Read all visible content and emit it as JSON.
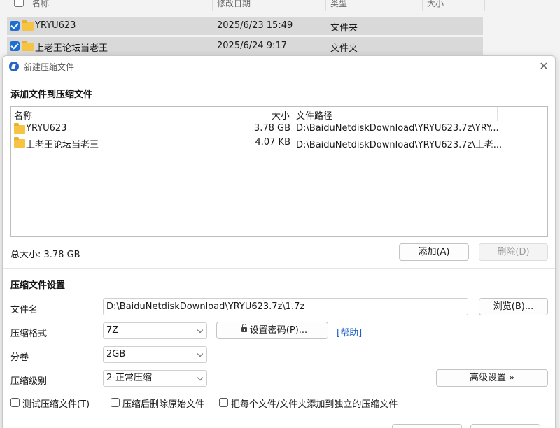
{
  "background_explorer": {
    "columns": [
      "名称",
      "修改日期",
      "类型",
      "大小"
    ],
    "rows": [
      {
        "name": "YRYU623",
        "date": "2025/6/23 15:49",
        "type": "文件夹"
      },
      {
        "name": "上老王论坛当老王",
        "date": "2025/6/24 9:17",
        "type": "文件夹"
      }
    ]
  },
  "dialog": {
    "title": "新建压缩文件",
    "add_section_title": "添加文件到压缩文件",
    "file_list": {
      "columns": {
        "name": "名称",
        "size": "大小",
        "path": "文件路径"
      },
      "rows": [
        {
          "name": "YRYU623",
          "size": "3.78 GB",
          "path": "D:\\BaiduNetdiskDownload\\YRYU623.7z\\YRY..."
        },
        {
          "name": "上老王论坛当老王",
          "size": "4.07 KB",
          "path": "D:\\BaiduNetdiskDownload\\YRYU623.7z\\上老..."
        }
      ]
    },
    "total_size": "总大小: 3.78 GB",
    "add_button": "添加(A)",
    "delete_button": "删除(D)",
    "settings_title": "压缩文件设置",
    "filename_label": "文件名",
    "filename_value": "D:\\BaiduNetdiskDownload\\YRYU623.7z\\1.7z",
    "browse_button": "浏览(B)...",
    "format_label": "压缩格式",
    "format_value": "7Z",
    "set_password_button": "设置密码(P)...",
    "help_link": "[帮助]",
    "volume_label": "分卷",
    "volume_value": "2GB",
    "level_label": "压缩级别",
    "level_value": "2-正常压缩",
    "advanced_button": "高级设置 »",
    "checkboxes": {
      "test": "测试压缩文件(T)",
      "delete_after": "压缩后删除原始文件",
      "separate": "把每个文件/文件夹添加到独立的压缩文件"
    }
  }
}
